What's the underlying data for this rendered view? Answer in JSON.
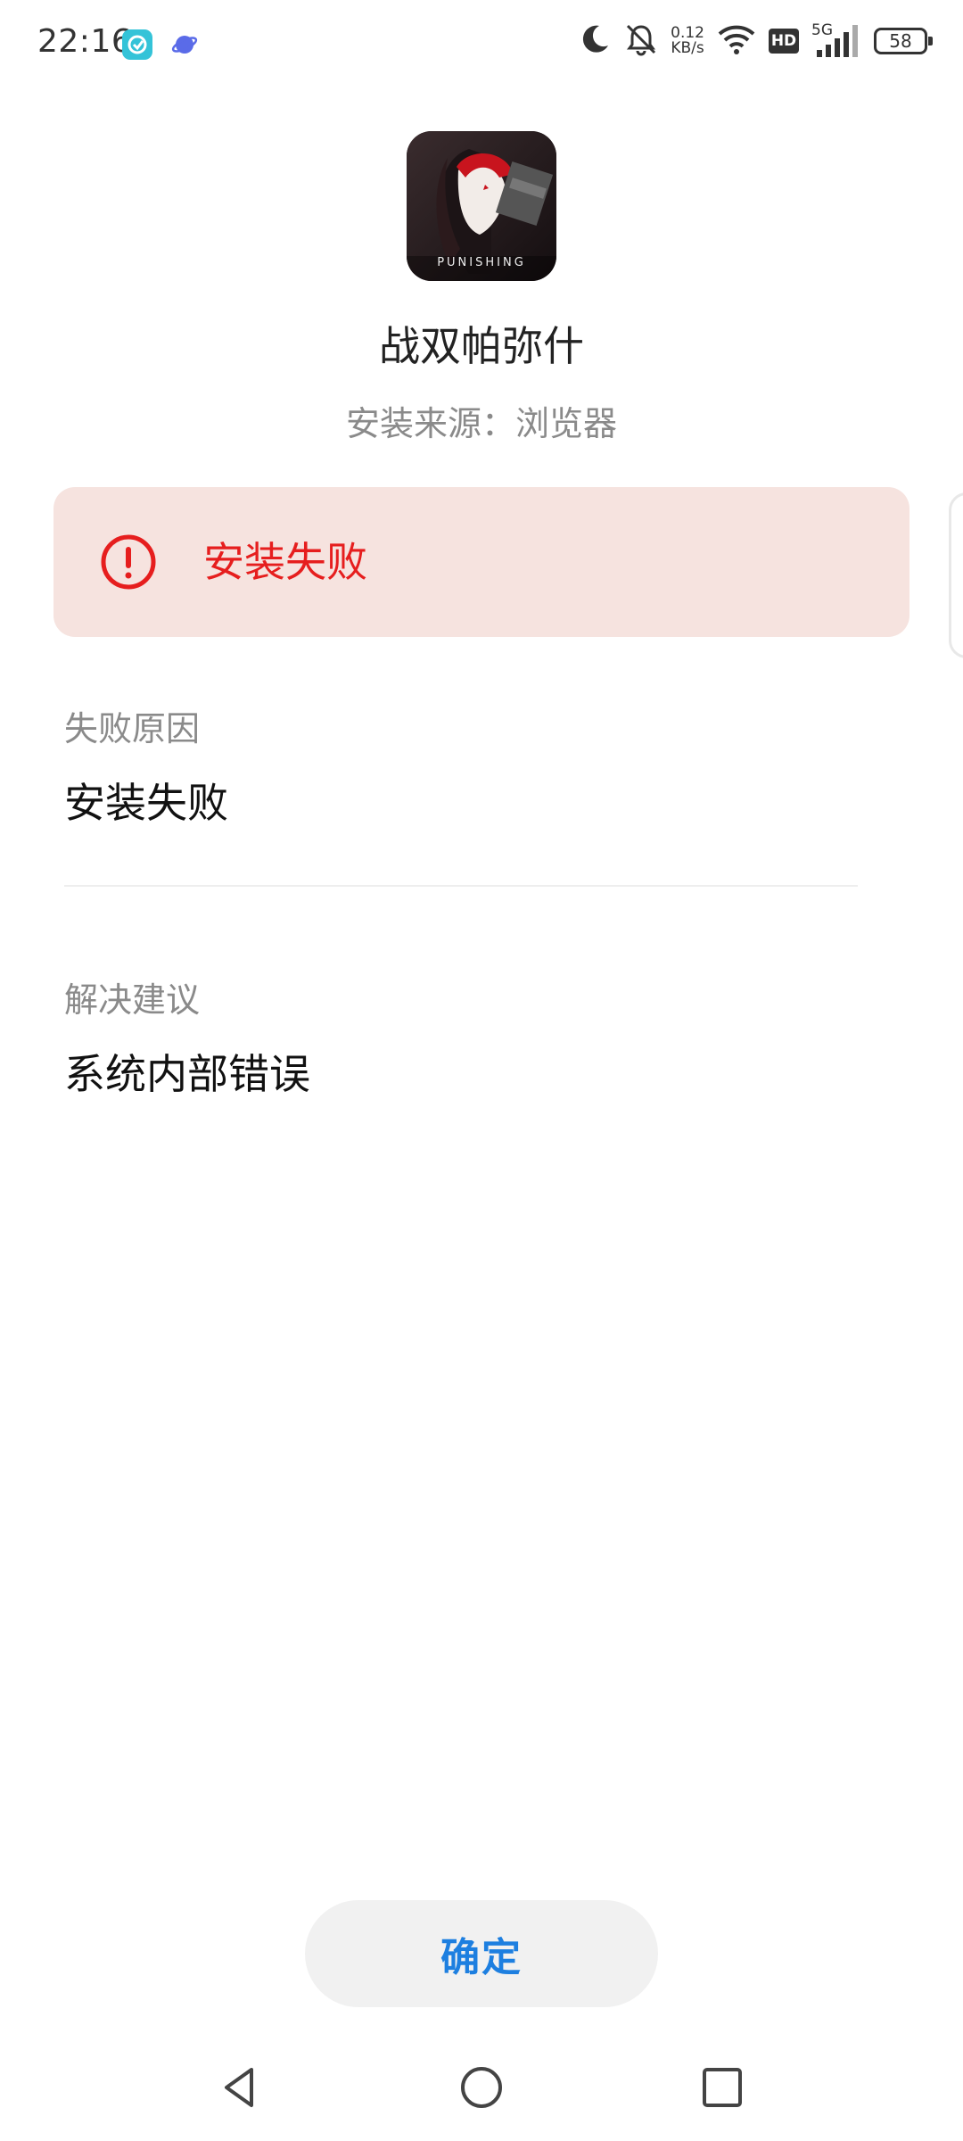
{
  "status_bar": {
    "time": "22:16",
    "net_speed_value": "0.12",
    "net_speed_unit": "KB/s",
    "hd_label": "HD",
    "signal_label": "5G",
    "battery": "58",
    "icons": [
      "app-notification-icon",
      "browser-icon",
      "moon-icon",
      "mute-bell-icon",
      "wifi-icon",
      "signal-icon",
      "battery-icon"
    ]
  },
  "app": {
    "name": "战双帕弥什",
    "install_source": "安装来源：浏览器",
    "icon_caption": "PUNISHING"
  },
  "error": {
    "title": "安装失败",
    "color": "#e61e1e",
    "background": "#f6e3df"
  },
  "failure_reason": {
    "label": "失败原因",
    "value": "安装失败"
  },
  "suggestion": {
    "label": "解决建议",
    "value": "系统内部错误"
  },
  "actions": {
    "confirm_label": "确定",
    "accent_color": "#1d7fe0"
  },
  "navigation": {
    "items": [
      "back-icon",
      "home-icon",
      "recent-apps-icon"
    ]
  }
}
